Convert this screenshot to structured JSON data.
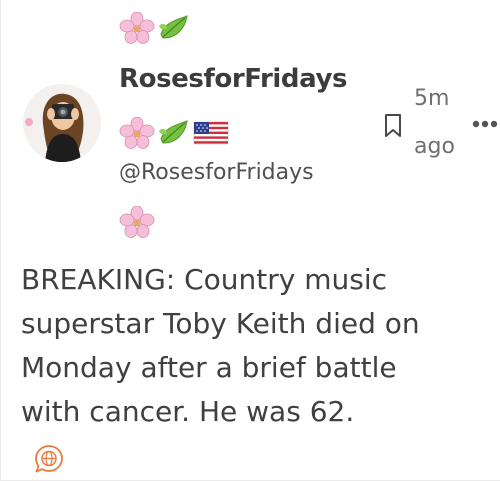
{
  "post": {
    "display_name": "RosesforFridays",
    "handle": "@RosesforFridays",
    "time_line1": "5m",
    "time_line2": "ago",
    "body_lines": [
      "BREAKING: Country music",
      "superstar Toby Keith died on",
      "Monday after a brief battle",
      "with cancer. He was 62."
    ]
  },
  "icons": {
    "decor_top": [
      "cherry-blossom",
      "leaf"
    ],
    "decor_mid": [
      "cherry-blossom",
      "leaf",
      "us-flag"
    ],
    "decor_low": [
      "cherry-blossom"
    ],
    "bookmark": "bookmark-outline",
    "more": "horizontal-ellipsis",
    "translate": "globe-in-speech-bubble"
  },
  "colors": {
    "blossom": "#f2b8d4",
    "blossom_center": "#e0a35a",
    "leaf": "#7cc242",
    "accent_orange": "#e8793d",
    "text": "#404040",
    "muted": "#6f6f6f"
  }
}
